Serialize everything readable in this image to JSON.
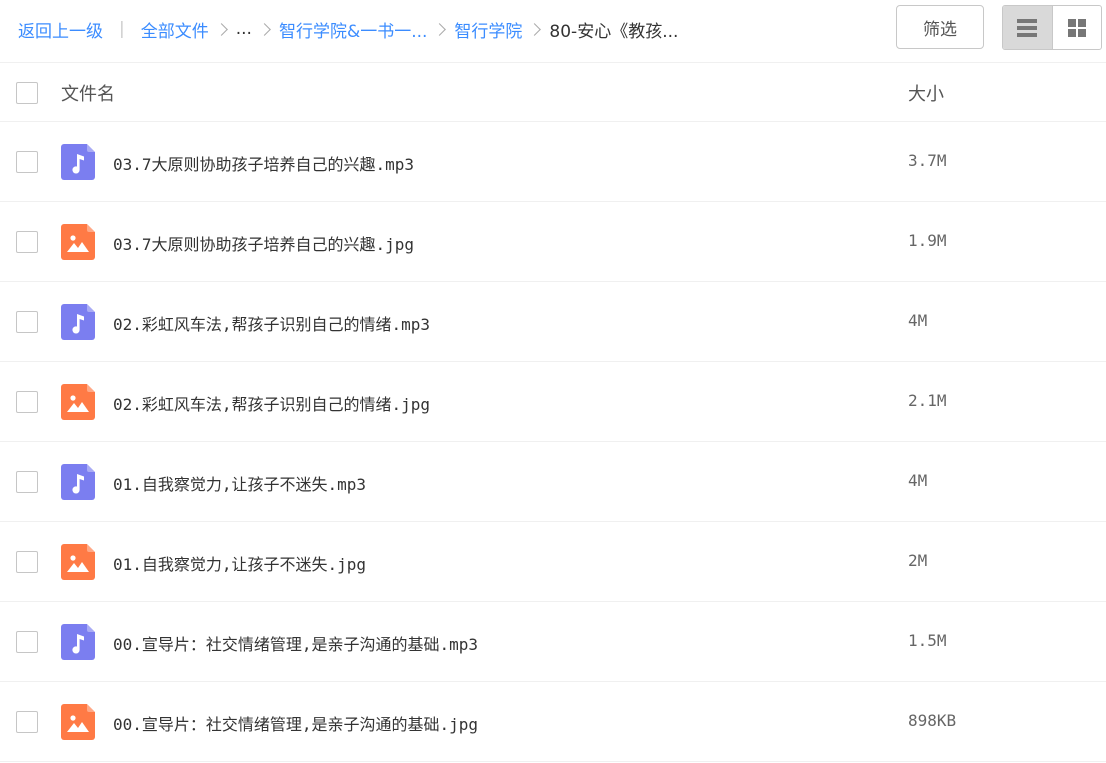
{
  "breadcrumb": {
    "back": "返回上一级",
    "all_files": "全部文件",
    "ellipsis": "...",
    "folder1": "智行学院&一书一...",
    "folder2": "智行学院",
    "current": "80-安心《教孩..."
  },
  "toolbar": {
    "filter_label": "筛选",
    "view_modes": [
      "list-view-icon",
      "grid-view-icon"
    ],
    "active_view": "list"
  },
  "table": {
    "header_name": "文件名",
    "header_size": "大小",
    "rows": [
      {
        "name": "03.7大原则协助孩子培养自己的兴趣.mp3",
        "size": "3.7M",
        "type": "audio"
      },
      {
        "name": "03.7大原则协助孩子培养自己的兴趣.jpg",
        "size": "1.9M",
        "type": "image"
      },
      {
        "name": "02.彩虹风车法,帮孩子识别自己的情绪.mp3",
        "size": "4M",
        "type": "audio"
      },
      {
        "name": "02.彩虹风车法,帮孩子识别自己的情绪.jpg",
        "size": "2.1M",
        "type": "image"
      },
      {
        "name": "01.自我察觉力,让孩子不迷失.mp3",
        "size": "4M",
        "type": "audio"
      },
      {
        "name": "01.自我察觉力,让孩子不迷失.jpg",
        "size": "2M",
        "type": "image"
      },
      {
        "name": "00.宣导片：社交情绪管理,是亲子沟通的基础.mp3",
        "size": "1.5M",
        "type": "audio"
      },
      {
        "name": "00.宣导片：社交情绪管理,是亲子沟通的基础.jpg",
        "size": "898KB",
        "type": "image"
      }
    ]
  },
  "colors": {
    "link": "#3b8cff",
    "audio_icon": "#7b7ef0",
    "image_icon": "#ff7a45"
  }
}
